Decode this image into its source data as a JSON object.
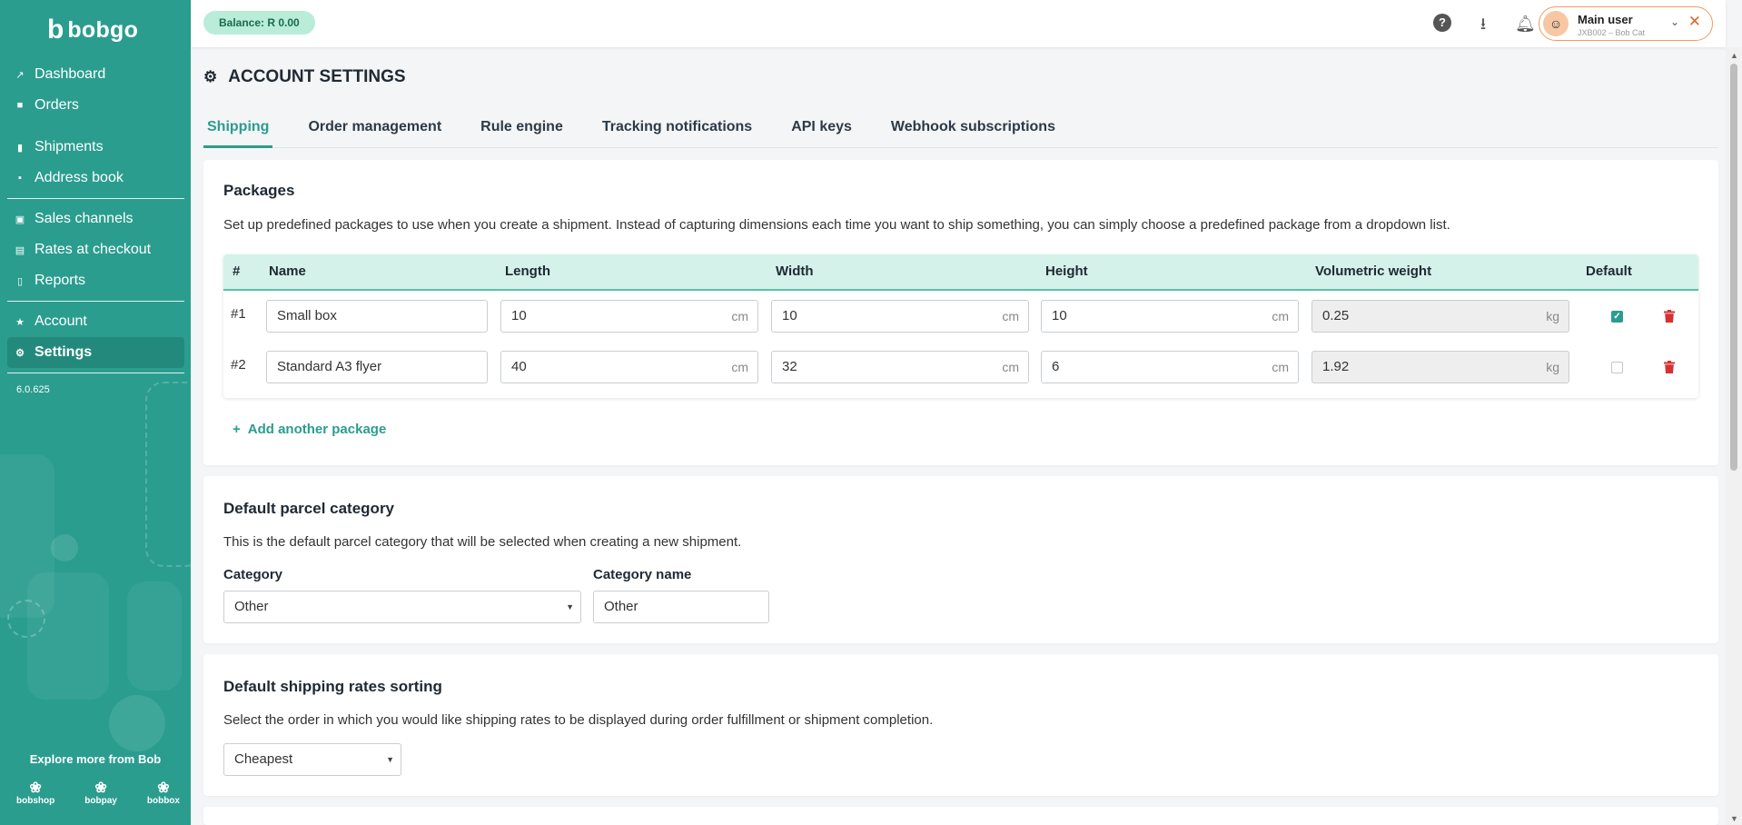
{
  "brand": {
    "logo_mark": "b",
    "logo_word": "bobgo"
  },
  "sidebar": {
    "items": [
      {
        "label": "Dashboard",
        "icon": "chart-line-icon"
      },
      {
        "label": "Orders",
        "icon": "basket-icon"
      },
      {
        "label": "Shipments",
        "icon": "truck-icon"
      },
      {
        "label": "Address book",
        "icon": "book-icon"
      },
      {
        "label": "Sales channels",
        "icon": "sitemap-icon"
      },
      {
        "label": "Rates at checkout",
        "icon": "calculator-icon"
      },
      {
        "label": "Reports",
        "icon": "file-icon"
      },
      {
        "label": "Account",
        "icon": "star-icon"
      },
      {
        "label": "Settings",
        "icon": "gear-icon"
      }
    ],
    "version": "6.0.625",
    "explore": "Explore more from Bob",
    "products": [
      "bobshop",
      "bobpay",
      "bobbox"
    ]
  },
  "topbar": {
    "balance": "Balance: R 0.00",
    "user_name": "Main user",
    "user_sub": "JXB002 – Bob Cat"
  },
  "page": {
    "title": "ACCOUNT SETTINGS"
  },
  "tabs": [
    "Shipping",
    "Order management",
    "Rule engine",
    "Tracking notifications",
    "API keys",
    "Webhook subscriptions"
  ],
  "packages": {
    "title": "Packages",
    "description": "Set up predefined packages to use when you create a shipment. Instead of capturing dimensions each time you want to ship something, you can simply choose a predefined package from a dropdown list.",
    "columns": [
      "#",
      "Name",
      "Length",
      "Width",
      "Height",
      "Volumetric weight",
      "Default"
    ],
    "rows": [
      {
        "num": "#1",
        "name": "Small box",
        "length": "10",
        "width": "10",
        "height": "10",
        "vol_weight": "0.25",
        "default": true
      },
      {
        "num": "#2",
        "name": "Standard A3 flyer",
        "length": "40",
        "width": "32",
        "height": "6",
        "vol_weight": "1.92",
        "default": false
      }
    ],
    "unit_cm": "cm",
    "unit_kg": "kg",
    "add_label": "Add another package"
  },
  "parcel_category": {
    "title": "Default parcel category",
    "description": "This is the default parcel category that will be selected when creating a new shipment.",
    "category_label": "Category",
    "category_value": "Other",
    "category_name_label": "Category name",
    "category_name_value": "Other"
  },
  "rates_sorting": {
    "title": "Default shipping rates sorting",
    "description": "Select the order in which you would like shipping rates to be displayed during order fulfillment or shipment completion.",
    "value": "Cheapest"
  },
  "colors": {
    "brand_teal": "#2a9d8f",
    "delete_red": "#d63031",
    "balance_bg": "#b9ecd9",
    "user_border": "#f29b5c"
  }
}
